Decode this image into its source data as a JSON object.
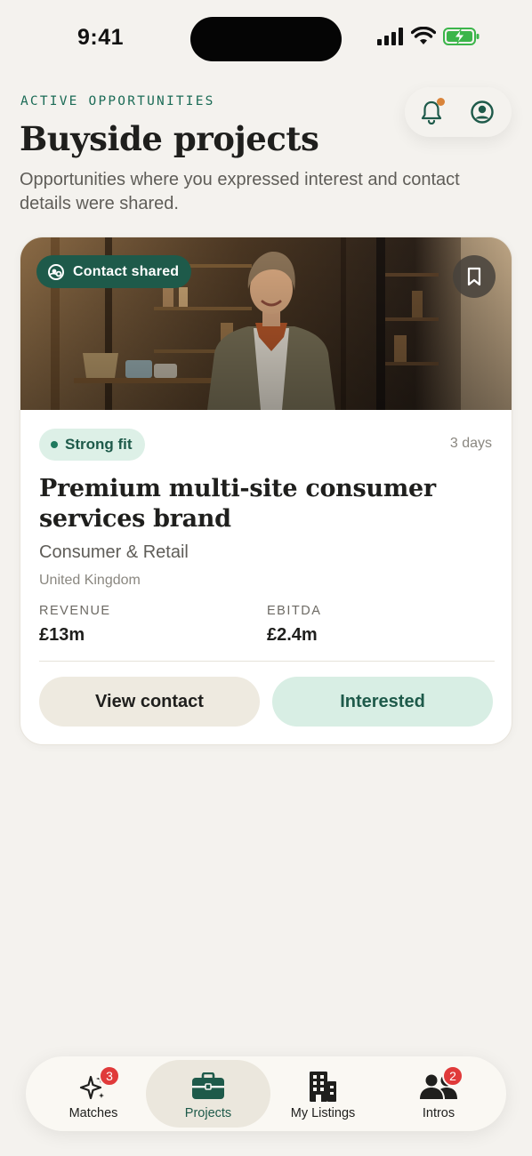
{
  "status_bar": {
    "time": "9:41"
  },
  "header": {
    "eyebrow": "ACTIVE OPPORTUNITIES",
    "title": "Buyside projects",
    "subtitle": "Opportunities where you expressed interest and contact details were shared.",
    "notifications_icon": "bell-icon",
    "profile_icon": "user-circle-icon",
    "notification_dot_color": "#d9843a"
  },
  "card": {
    "contact_badge": "Contact shared",
    "fit_badge": "Strong fit",
    "age": "3 days",
    "title": "Premium multi-site consumer services brand",
    "sector": "Consumer & Retail",
    "country": "United Kingdom",
    "metrics": [
      {
        "label": "REVENUE",
        "value": "£13m"
      },
      {
        "label": "EBITDA",
        "value": "£2.4m"
      }
    ],
    "actions": {
      "view_contact": "View contact",
      "interested": "Interested"
    }
  },
  "nav": {
    "items": [
      {
        "label": "Matches",
        "icon": "sparkles-icon",
        "badge": "3"
      },
      {
        "label": "Projects",
        "icon": "briefcase-icon",
        "active": true
      },
      {
        "label": "My Listings",
        "icon": "building-icon"
      },
      {
        "label": "Intros",
        "icon": "people-icon",
        "badge": "2"
      }
    ]
  },
  "colors": {
    "accent": "#1e5a4a",
    "background": "#f4f2ee",
    "badge_red": "#e03a3a"
  }
}
